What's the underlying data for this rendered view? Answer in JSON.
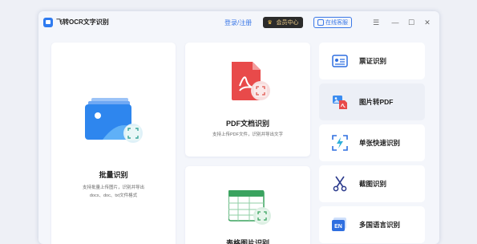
{
  "app": {
    "title": "飞转OCR文字识别"
  },
  "header": {
    "login_label": "登录/注册",
    "member_label": "会员中心",
    "service_label": "在线客服"
  },
  "cards": {
    "batch": {
      "title": "批量识别",
      "desc1": "支持批量上传图片，识别并导出",
      "desc2": "docx、doc、txt文件格式"
    },
    "pdf": {
      "title": "PDF文档识别",
      "desc": "支持上传PDF文件，识别并导出文字"
    },
    "table": {
      "title": "表格图片识别"
    }
  },
  "sidebar": {
    "items": [
      {
        "label": "票证识别",
        "icon": "ticket-icon"
      },
      {
        "label": "图片转PDF",
        "icon": "image-to-pdf-icon"
      },
      {
        "label": "单张快速识别",
        "icon": "quick-scan-icon"
      },
      {
        "label": "截图识别",
        "icon": "scissors-icon"
      },
      {
        "label": "多国语言识别",
        "icon": "language-en-icon"
      }
    ]
  },
  "colors": {
    "accent": "#3b78e7",
    "pdf_red": "#e84a4a",
    "table_green": "#3aa35f",
    "member_bg": "#2b2b2b"
  }
}
